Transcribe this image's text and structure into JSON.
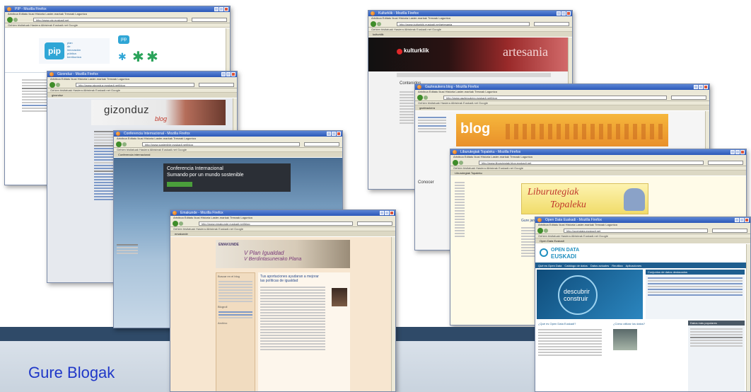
{
  "slide": {
    "footer_title": "Gure Blogak"
  },
  "browser": {
    "menu": "Artxiboa  Editatu  Ikusi  Historia  Laster-markak  Tresnak  Laguntza",
    "bookmarks": "Gehien bisitatuak  Hasiera  Albisteak  Euskadi.net  Google"
  },
  "windows": {
    "pip": {
      "title": "PIP - Mozilla Firefox",
      "url": "http://www.pip.euskadi.net",
      "logo_text": "pip",
      "tagline": [
        "plan",
        "de",
        "innovación",
        "pública",
        "berrikuntza",
        "publikoaren",
        "plana"
      ],
      "right_logo": "pip"
    },
    "gizonduz": {
      "title": "Gizonduz - Mozilla Firefox",
      "url": "http://www.gizonduz.euskadi.net/blog",
      "tab": "gizonduz",
      "header_title": "gizonduz",
      "header_sub": "blog"
    },
    "conferencia": {
      "title": "Conferencia Internacional - Mozilla Firefox",
      "url": "http://www.sostenible.euskadi.net/blog",
      "tab": "Conferencia internacional",
      "heading_line1": "Conferencia Internacional",
      "heading_line2": "Sumando por un mundo sostenible"
    },
    "emakunde": {
      "title": "Emakunde - Mozilla Firefox",
      "url": "http://www.emakunde.euskadi.net/blog",
      "tab": "emakunde",
      "header_brand": "EMAKUNDE",
      "header_line1": "V Plan Igualdad",
      "header_line2": "V Berdintasunerako Plana",
      "post_title": "Tus aportaciones ayudaran a mejorar las políticas de igualdad",
      "sidebar_heading": "Buscar en el blog",
      "sidebar_heading2": "Blogroll",
      "sidebar_heading3": "Archivo"
    },
    "kulturklik": {
      "title": "Kulturklik - Mozilla Firefox",
      "url": "http://www.kulturklik.euskadi.net/artesania",
      "tab": "kulturklik",
      "brand": "kulturklik",
      "banner_word": "artesania",
      "section_title": "Contenidos"
    },
    "gazteaukera": {
      "title": "Gazteaukera blog - Mozilla Firefox",
      "url": "http://www.gazteaukera.euskadi.net/blog",
      "tab": "gazteaukera",
      "banner_word": "blog",
      "section_title": "Conocer"
    },
    "liburutegiak": {
      "title": "Liburutegiak Topaleku - Mozilla Firefox",
      "url": "http://www.liburutegiak.blog.euskadi.net",
      "tab": "Liburutegiak Topaleku",
      "banner_line1": "Liburutegiak",
      "banner_line2": "Topaleku",
      "post_title": "Gure jarduerak, liburutegiaren albisteak"
    },
    "opendata": {
      "title": "Open Data Euskadi - Mozilla Firefox",
      "url": "http://opendata.euskadi.net",
      "tab": "Open Data Euskadi",
      "brand_line1": "OPEN DATA",
      "brand_line2": "EUSKADI",
      "nav": [
        "Qué es Open Data",
        "Catálogo de datos",
        "Datos actuales",
        "Reutiliza",
        "Aplicaciones"
      ],
      "hero_line1": "descubrir",
      "hero_line2": "construir",
      "featured_heading": "Conjuntos de datos destacados",
      "what_heading": "¿Qué es Open Data Euskadi?",
      "why_heading": "¿Cómo utilizar los datos?",
      "right_heading": "Datos más populares"
    }
  },
  "colors": {
    "band_dark": "#2f4a68",
    "band_light": "#d4dce6",
    "footer_text": "#1f37c8",
    "titlebar": "#2b58b8"
  }
}
